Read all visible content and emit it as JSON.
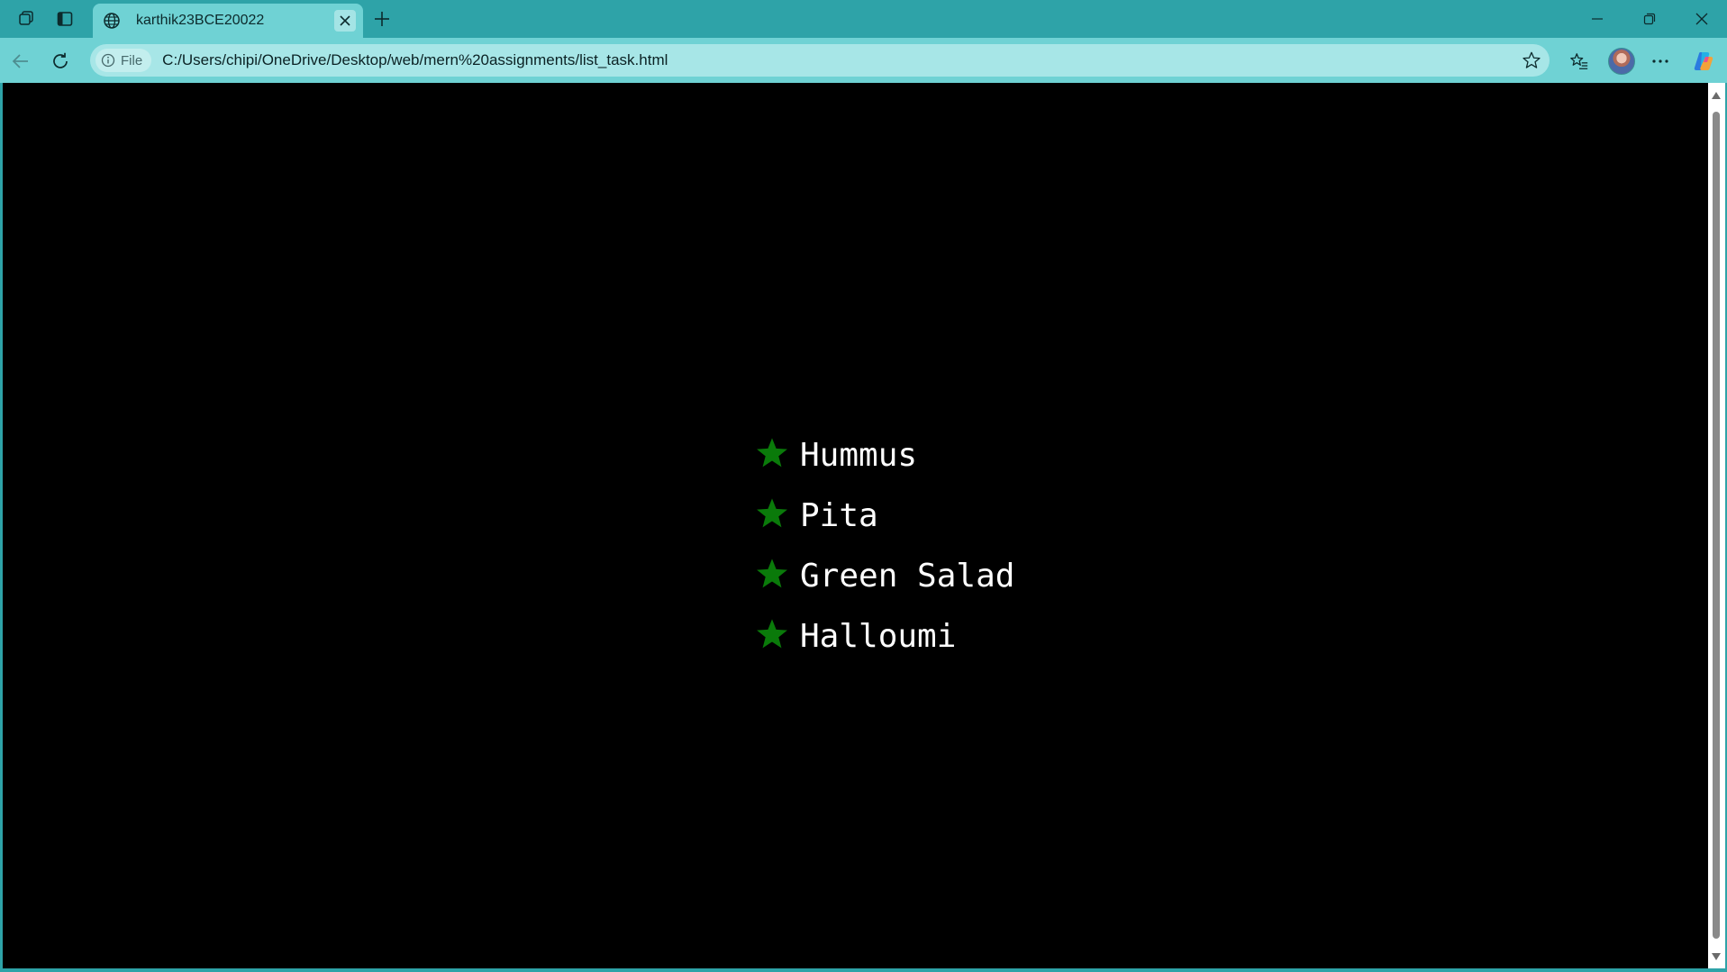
{
  "browser": {
    "tab": {
      "title": "karthik23BCE20022",
      "favicon": "globe-icon"
    },
    "address_bar": {
      "site_info_label": "File",
      "url": "C:/Users/chipi/OneDrive/Desktop/web/mern%20assignments/list_task.html"
    },
    "icons": {
      "workspaces": "workspaces-icon",
      "tab_actions": "tab-actions-icon",
      "new_tab": "plus-icon",
      "close_tab": "close-icon",
      "minimize": "minimize-icon",
      "restore": "restore-icon",
      "close_window": "close-icon",
      "back": "back-arrow-icon",
      "reload": "reload-icon",
      "info": "info-icon",
      "favorite": "star-outline-icon",
      "favorites": "favorites-icon",
      "profile": "avatar",
      "more": "more-icon",
      "copilot": "copilot-icon"
    },
    "colors": {
      "frame": "#2ea3a8",
      "toolbar": "#6fd2d4",
      "address_bar": "#a7e6e7"
    }
  },
  "page": {
    "background": "#000000",
    "bullet_color": "#0a7a0a",
    "bullet_icon": "star-icon",
    "items": [
      {
        "label": "Hummus"
      },
      {
        "label": "Pita"
      },
      {
        "label": "Green Salad"
      },
      {
        "label": "Halloumi"
      }
    ]
  }
}
